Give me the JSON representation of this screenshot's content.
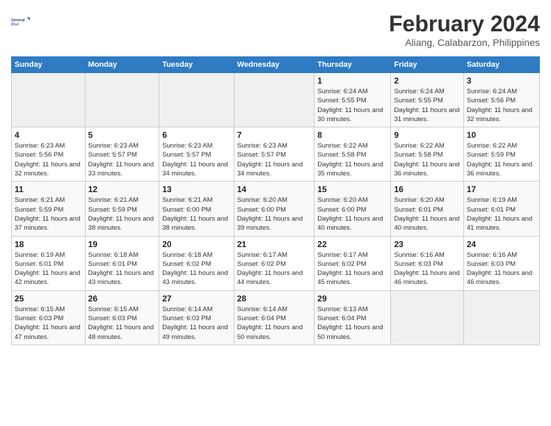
{
  "header": {
    "logo_line1": "General",
    "logo_line2": "Blue",
    "main_title": "February 2024",
    "subtitle": "Aliang, Calabarzon, Philippines"
  },
  "calendar": {
    "days_of_week": [
      "Sunday",
      "Monday",
      "Tuesday",
      "Wednesday",
      "Thursday",
      "Friday",
      "Saturday"
    ],
    "weeks": [
      [
        {
          "day": "",
          "empty": true
        },
        {
          "day": "",
          "empty": true
        },
        {
          "day": "",
          "empty": true
        },
        {
          "day": "",
          "empty": true
        },
        {
          "day": "1",
          "sunrise": "6:24 AM",
          "sunset": "5:55 PM",
          "daylight": "11 hours and 30 minutes."
        },
        {
          "day": "2",
          "sunrise": "6:24 AM",
          "sunset": "5:55 PM",
          "daylight": "11 hours and 31 minutes."
        },
        {
          "day": "3",
          "sunrise": "6:24 AM",
          "sunset": "5:56 PM",
          "daylight": "11 hours and 32 minutes."
        }
      ],
      [
        {
          "day": "4",
          "sunrise": "6:23 AM",
          "sunset": "5:56 PM",
          "daylight": "11 hours and 32 minutes."
        },
        {
          "day": "5",
          "sunrise": "6:23 AM",
          "sunset": "5:57 PM",
          "daylight": "11 hours and 33 minutes."
        },
        {
          "day": "6",
          "sunrise": "6:23 AM",
          "sunset": "5:57 PM",
          "daylight": "11 hours and 34 minutes."
        },
        {
          "day": "7",
          "sunrise": "6:23 AM",
          "sunset": "5:57 PM",
          "daylight": "11 hours and 34 minutes."
        },
        {
          "day": "8",
          "sunrise": "6:22 AM",
          "sunset": "5:58 PM",
          "daylight": "11 hours and 35 minutes."
        },
        {
          "day": "9",
          "sunrise": "6:22 AM",
          "sunset": "5:58 PM",
          "daylight": "11 hours and 36 minutes."
        },
        {
          "day": "10",
          "sunrise": "6:22 AM",
          "sunset": "5:59 PM",
          "daylight": "11 hours and 36 minutes."
        }
      ],
      [
        {
          "day": "11",
          "sunrise": "6:21 AM",
          "sunset": "5:59 PM",
          "daylight": "11 hours and 37 minutes."
        },
        {
          "day": "12",
          "sunrise": "6:21 AM",
          "sunset": "5:59 PM",
          "daylight": "11 hours and 38 minutes."
        },
        {
          "day": "13",
          "sunrise": "6:21 AM",
          "sunset": "6:00 PM",
          "daylight": "11 hours and 38 minutes."
        },
        {
          "day": "14",
          "sunrise": "6:20 AM",
          "sunset": "6:00 PM",
          "daylight": "11 hours and 39 minutes."
        },
        {
          "day": "15",
          "sunrise": "6:20 AM",
          "sunset": "6:00 PM",
          "daylight": "11 hours and 40 minutes."
        },
        {
          "day": "16",
          "sunrise": "6:20 AM",
          "sunset": "6:01 PM",
          "daylight": "11 hours and 40 minutes."
        },
        {
          "day": "17",
          "sunrise": "6:19 AM",
          "sunset": "6:01 PM",
          "daylight": "11 hours and 41 minutes."
        }
      ],
      [
        {
          "day": "18",
          "sunrise": "6:19 AM",
          "sunset": "6:01 PM",
          "daylight": "11 hours and 42 minutes."
        },
        {
          "day": "19",
          "sunrise": "6:18 AM",
          "sunset": "6:01 PM",
          "daylight": "11 hours and 43 minutes."
        },
        {
          "day": "20",
          "sunrise": "6:18 AM",
          "sunset": "6:02 PM",
          "daylight": "11 hours and 43 minutes."
        },
        {
          "day": "21",
          "sunrise": "6:17 AM",
          "sunset": "6:02 PM",
          "daylight": "11 hours and 44 minutes."
        },
        {
          "day": "22",
          "sunrise": "6:17 AM",
          "sunset": "6:02 PM",
          "daylight": "11 hours and 45 minutes."
        },
        {
          "day": "23",
          "sunrise": "6:16 AM",
          "sunset": "6:03 PM",
          "daylight": "11 hours and 46 minutes."
        },
        {
          "day": "24",
          "sunrise": "6:16 AM",
          "sunset": "6:03 PM",
          "daylight": "11 hours and 46 minutes."
        }
      ],
      [
        {
          "day": "25",
          "sunrise": "6:15 AM",
          "sunset": "6:03 PM",
          "daylight": "11 hours and 47 minutes."
        },
        {
          "day": "26",
          "sunrise": "6:15 AM",
          "sunset": "6:03 PM",
          "daylight": "11 hours and 48 minutes."
        },
        {
          "day": "27",
          "sunrise": "6:14 AM",
          "sunset": "6:03 PM",
          "daylight": "11 hours and 49 minutes."
        },
        {
          "day": "28",
          "sunrise": "6:14 AM",
          "sunset": "6:04 PM",
          "daylight": "11 hours and 50 minutes."
        },
        {
          "day": "29",
          "sunrise": "6:13 AM",
          "sunset": "6:04 PM",
          "daylight": "11 hours and 50 minutes."
        },
        {
          "day": "",
          "empty": true
        },
        {
          "day": "",
          "empty": true
        }
      ]
    ]
  },
  "labels": {
    "sunrise": "Sunrise:",
    "sunset": "Sunset:",
    "daylight": "Daylight:"
  }
}
